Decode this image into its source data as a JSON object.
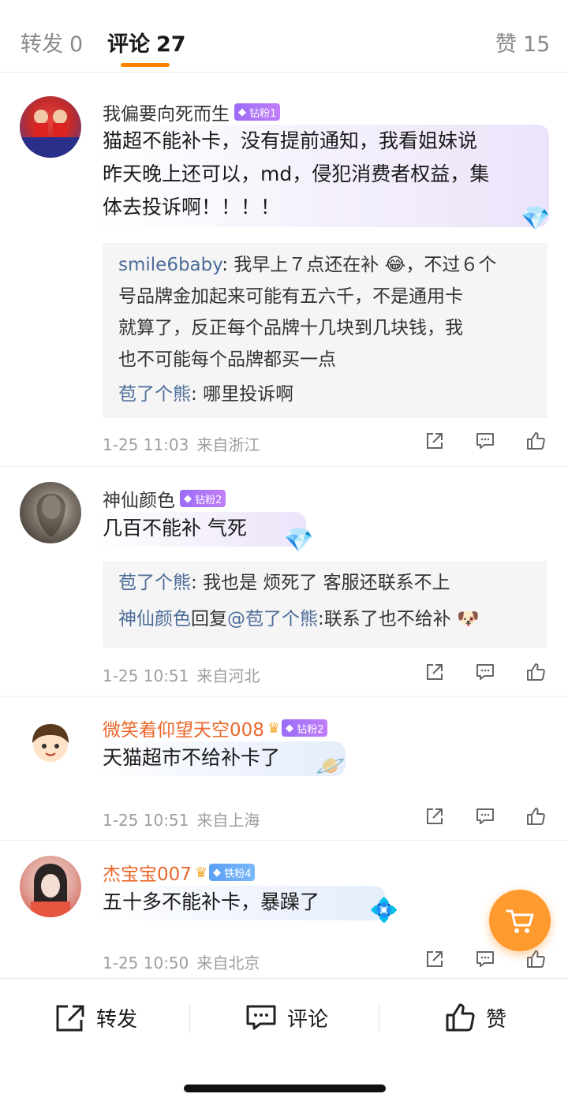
{
  "tabs": {
    "repost_label": "转发",
    "repost_count": "0",
    "comment_label": "评论",
    "comment_count": "27",
    "like_label": "赞",
    "like_count": "15"
  },
  "comments": [
    {
      "user": "我偏要向死而生",
      "badge": "钻粉1",
      "text": "猫超不能补卡，没有提前通知，我看姐妹说昨天晚上还可以，md，侵犯消费者权益，集体去投诉啊！！！！",
      "text_lines": [
        "猫超不能补卡，没有提前通知，我看姐妹说",
        "昨天晚上还可以，md，侵犯消费者权益，集",
        "体去投诉啊！！！！"
      ],
      "replies": [
        {
          "name": "smile6baby",
          "lines": [
            "我早上７点还在补 😂，不过６个",
            "号品牌金加起来可能有五六千，不是通用卡",
            "就算了，反正每个品牌十几块到几块钱，我",
            "也不可能每个品牌都买一点"
          ]
        },
        {
          "name": "苞了个熊",
          "lines": [
            "哪里投诉啊"
          ]
        }
      ],
      "date": "1-25 11:03",
      "location": "来自浙江"
    },
    {
      "user": "神仙颜色",
      "badge": "钻粉2",
      "text": "几百不能补 气死",
      "replies": [
        {
          "name": "苞了个熊",
          "text": "我也是 烦死了 客服还联系不上"
        },
        {
          "name": "神仙颜色",
          "reply_word": "回复",
          "mention": "@苞了个熊",
          "text": "联系了也不给补 🐶"
        }
      ],
      "date": "1-25 10:51",
      "location": "来自河北"
    },
    {
      "user": "微笑着仰望天空008",
      "badge": "钻粉2",
      "text": "天猫超市不给补卡了",
      "date": "1-25 10:51",
      "location": "来自上海"
    },
    {
      "user": "杰宝宝007",
      "badge": "铁粉4",
      "text": "五十多不能补卡，暴躁了",
      "date": "1-25 10:50",
      "location": "来自北京"
    }
  ],
  "bottom_bar": {
    "repost": "转发",
    "comment": "评论",
    "like": "赞"
  },
  "icons": {
    "share": "share-icon",
    "comment": "comment-icon",
    "like": "thumb-up-icon",
    "cart": "cart-icon"
  },
  "colors": {
    "accent": "#ff8200",
    "reply_name": "#4d6d99",
    "vip_name": "#e9682d",
    "diamond_badge": "#9b6cf7",
    "iron_badge": "#5aa0f5",
    "cart": "#ff9a2e"
  }
}
